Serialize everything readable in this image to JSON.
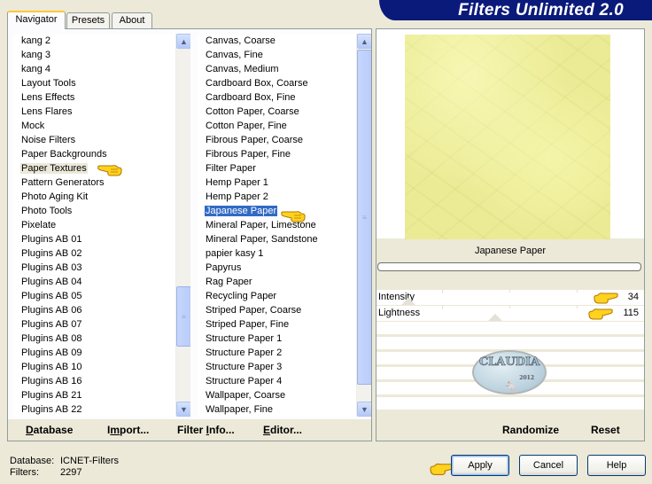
{
  "app": {
    "title": "Filters Unlimited 2.0"
  },
  "tabs": [
    {
      "label": "Navigator",
      "active": true
    },
    {
      "label": "Presets",
      "active": false
    },
    {
      "label": "About",
      "active": false
    }
  ],
  "categories": {
    "items": [
      "kang 2",
      "kang 3",
      "kang 4",
      "Layout Tools",
      "Lens Effects",
      "Lens Flares",
      "Mock",
      "Noise Filters",
      "Paper Backgrounds",
      "Paper Textures",
      "Pattern Generators",
      "Photo Aging Kit",
      "Photo Tools",
      "Pixelate",
      "Plugins AB 01",
      "Plugins AB 02",
      "Plugins AB 03",
      "Plugins AB 04",
      "Plugins AB 05",
      "Plugins AB 06",
      "Plugins AB 07",
      "Plugins AB 08",
      "Plugins AB 09",
      "Plugins AB 10",
      "Plugins AB 16",
      "Plugins AB 21",
      "Plugins AB 22"
    ],
    "selected": "Paper Textures"
  },
  "filters": {
    "items": [
      "Canvas, Coarse",
      "Canvas, Fine",
      "Canvas, Medium",
      "Cardboard Box, Coarse",
      "Cardboard Box, Fine",
      "Cotton Paper, Coarse",
      "Cotton Paper, Fine",
      "Fibrous Paper, Coarse",
      "Fibrous Paper, Fine",
      "Filter Paper",
      "Hemp Paper 1",
      "Hemp Paper 2",
      "Japanese Paper",
      "Mineral Paper, Limestone",
      "Mineral Paper, Sandstone",
      "papier kasy 1",
      "Papyrus",
      "Rag Paper",
      "Recycling Paper",
      "Striped Paper, Coarse",
      "Striped Paper, Fine",
      "Structure Paper 1",
      "Structure Paper 2",
      "Structure Paper 3",
      "Structure Paper 4",
      "Wallpaper, Coarse",
      "Wallpaper, Fine"
    ],
    "selected": "Japanese Paper"
  },
  "left_buttons": {
    "database": {
      "pre": "",
      "u": "D",
      "post": "atabase"
    },
    "import": {
      "pre": "I",
      "u": "m",
      "post": "port..."
    },
    "filter_info": {
      "pre": "Filter ",
      "u": "I",
      "post": "nfo..."
    },
    "editor": {
      "pre": "",
      "u": "E",
      "post": "ditor..."
    }
  },
  "preview": {
    "filter_name": "Japanese Paper",
    "progress": 0
  },
  "params": [
    {
      "label": "Intensity",
      "value": "34"
    },
    {
      "label": "Lightness",
      "value": "115"
    }
  ],
  "logo": {
    "text": "CLAUDIA",
    "year": "2012"
  },
  "right_buttons": {
    "randomize": "Randomize",
    "reset": "Reset"
  },
  "status": {
    "database_label": "Database:",
    "database_value": "ICNET-Filters",
    "filters_label": "Filters:",
    "filters_value": "2297"
  },
  "dialog_buttons": {
    "apply": "Apply",
    "cancel": "Cancel",
    "help": "Help"
  },
  "colors": {
    "banner": "#0a1a7a",
    "selection": "#316ac5",
    "preview_texture": "#ebeb95"
  }
}
